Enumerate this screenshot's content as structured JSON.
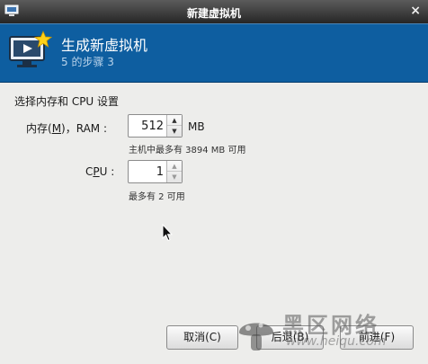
{
  "window": {
    "title": "新建虚拟机",
    "close_glyph": "×"
  },
  "banner": {
    "heading": "生成新虚拟机",
    "step": "5 的步骤 3",
    "icon": "monitor-star-icon"
  },
  "section": {
    "title": "选择内存和 CPU 设置"
  },
  "memory": {
    "label": "内存(M)，RAM :",
    "label_prefix": "内存(",
    "label_mnemonic": "M",
    "label_suffix": ")，RAM :",
    "value": "512",
    "unit": "MB",
    "hint": "主机中最多有 3894 MB 可用"
  },
  "cpu": {
    "label": "CPU :",
    "label_prefix": "C",
    "label_mnemonic": "P",
    "label_suffix": "U :",
    "value": "1",
    "hint": "最多有 2 可用"
  },
  "buttons": {
    "cancel": "取消(C)",
    "back": "后退(B)",
    "forward": "前进(F)"
  },
  "watermark": {
    "brand": "黑区网络",
    "url": "www.heiqu.com"
  }
}
